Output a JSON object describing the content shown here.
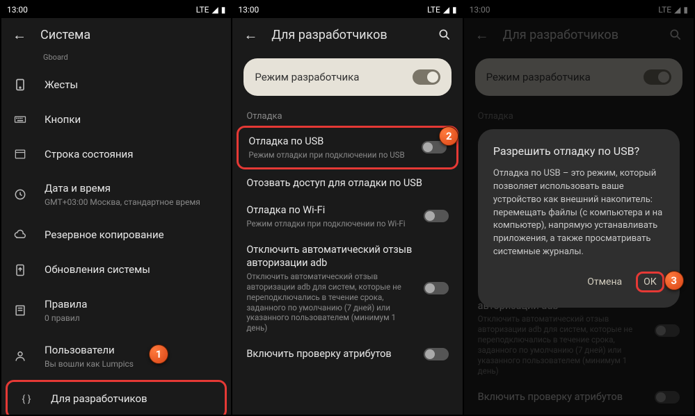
{
  "status": {
    "time": "13:00",
    "lte": "LTE"
  },
  "screen1": {
    "title": "Система",
    "gboard": "Gboard",
    "items": [
      {
        "title": "Жесты"
      },
      {
        "title": "Кнопки"
      },
      {
        "title": "Строка состояния"
      },
      {
        "title": "Дата и время",
        "sub": "GMT+03:00 Москва, стандартное время"
      },
      {
        "title": "Резервное копирование"
      },
      {
        "title": "Обновления системы"
      },
      {
        "title": "Правила",
        "sub": "0 правил"
      },
      {
        "title": "Пользователи",
        "sub": "Вы вошли как Lumpics"
      },
      {
        "title": "Для разработчиков"
      }
    ]
  },
  "screen2": {
    "title": "Для разработчиков",
    "dev_mode": "Режим разработчика",
    "section": "Отладка",
    "items": [
      {
        "title": "Отладка по USB",
        "sub": "Режим отладки при подключении по USB"
      },
      {
        "title": "Отозвать доступ для отладки по USB"
      },
      {
        "title": "Отладка по Wi-Fi",
        "sub": "Режим отладки при подключении по Wi-Fi"
      },
      {
        "title": "Отключить автоматический отзыв авторизации adb",
        "sub": "Отключить автоматический отзыв авторизации adb для систем, которые не переподключались в течение срока, заданного по умолчанию (7 дней) или указанного пользователем (минимум 1 день)"
      },
      {
        "title": "Включить проверку атрибутов"
      }
    ]
  },
  "screen3": {
    "dialog": {
      "title": "Разрешить отладку по USB?",
      "body": "Отладка по USB – это режим, который позволяет использовать ваше устройство как внешний накопитель: перемещать файлы (с компьютера и на компьютер), напрямую устанавливать приложения, а также просматривать системные журналы.",
      "cancel": "Отмена",
      "ok": "ОК"
    }
  },
  "badges": {
    "b1": "1",
    "b2": "2",
    "b3": "3"
  }
}
